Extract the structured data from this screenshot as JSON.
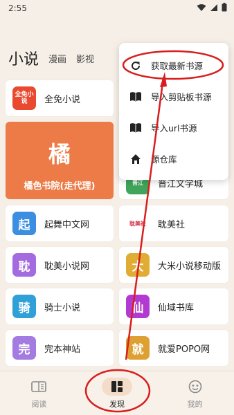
{
  "status": {
    "time": "2:55"
  },
  "tabs": [
    {
      "label": "小说",
      "active": true
    },
    {
      "label": "漫画",
      "active": false
    },
    {
      "label": "影视",
      "active": false
    }
  ],
  "sources": {
    "featured": {
      "label": "橘色书院(走代理)",
      "char": "橘",
      "color": "#ec7b47"
    },
    "left": [
      {
        "name": "全免小说",
        "logo_text": "全免小说",
        "color": "#e8492f"
      },
      {
        "name": "起舞中文网",
        "logo_text": "起",
        "color": "#3b8ee0"
      },
      {
        "name": "耽美小说网",
        "logo_text": "耽",
        "color": "#a46ae0"
      },
      {
        "name": "骑士小说",
        "logo_text": "骑",
        "color": "#2fa1d8"
      },
      {
        "name": "完本神站",
        "logo_text": "完",
        "color": "#a47be0"
      }
    ],
    "right": [
      {
        "name": "晋江文学城",
        "logo_text": "晋江",
        "color": "#3fa55a"
      },
      {
        "name": "耽美社",
        "logo_text": "耽美社",
        "color": "#ffffff"
      },
      {
        "name": "大米小说移动版",
        "logo_text": "大",
        "color": "#e0ac34"
      },
      {
        "name": "仙域书库",
        "logo_text": "仙",
        "color": "#b23ad0"
      },
      {
        "name": "就爱POPO网",
        "logo_text": "就",
        "color": "#dea033"
      }
    ]
  },
  "menu": {
    "items": [
      {
        "label": "获取最新书源",
        "icon": "refresh-icon"
      },
      {
        "label": "导入剪贴板书源",
        "icon": "book-icon"
      },
      {
        "label": "导入url书源",
        "icon": "book-icon"
      },
      {
        "label": "源仓库",
        "icon": "home-icon"
      }
    ]
  },
  "nav": [
    {
      "label": "阅读",
      "icon": "reading-icon",
      "active": false
    },
    {
      "label": "发现",
      "icon": "discover-icon",
      "active": true
    },
    {
      "label": "我的",
      "icon": "profile-icon",
      "active": false
    }
  ],
  "colors": {
    "accent": "#ec7b47",
    "annotation": "#d81e1e",
    "background": "#f6efe7"
  }
}
